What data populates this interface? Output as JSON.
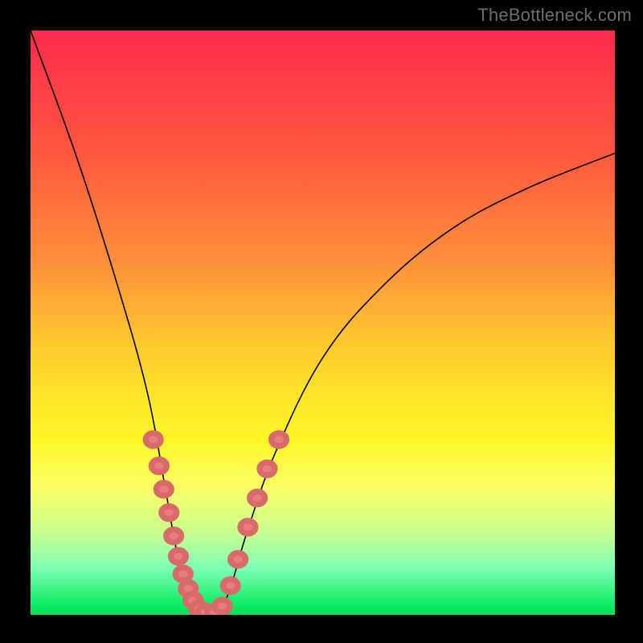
{
  "watermark": "TheBottleneck.com",
  "chart_data": {
    "type": "line",
    "title": "",
    "xlabel": "",
    "ylabel": "",
    "x_range": [
      0,
      100
    ],
    "y_range": [
      0,
      100
    ],
    "curve_left": {
      "name": "left-branch",
      "points": [
        {
          "x": 0,
          "y": 100
        },
        {
          "x": 8,
          "y": 78
        },
        {
          "x": 15,
          "y": 56
        },
        {
          "x": 20,
          "y": 38
        },
        {
          "x": 23,
          "y": 22
        },
        {
          "x": 25,
          "y": 11
        },
        {
          "x": 27,
          "y": 4
        },
        {
          "x": 29,
          "y": 0.5
        }
      ]
    },
    "curve_right": {
      "name": "right-branch",
      "points": [
        {
          "x": 32,
          "y": 0.5
        },
        {
          "x": 34,
          "y": 4
        },
        {
          "x": 37,
          "y": 14
        },
        {
          "x": 42,
          "y": 28
        },
        {
          "x": 50,
          "y": 44
        },
        {
          "x": 60,
          "y": 56
        },
        {
          "x": 72,
          "y": 66
        },
        {
          "x": 85,
          "y": 73
        },
        {
          "x": 100,
          "y": 79
        }
      ]
    },
    "highlight_band": {
      "y_min": 0,
      "y_max": 30,
      "description": "Overlay markers shown only where curves fall within lower band"
    },
    "markers_left": [
      {
        "x": 21.0,
        "y": 30.0
      },
      {
        "x": 22.0,
        "y": 25.5
      },
      {
        "x": 22.8,
        "y": 21.5
      },
      {
        "x": 23.7,
        "y": 17.5
      },
      {
        "x": 24.5,
        "y": 13.5
      },
      {
        "x": 25.3,
        "y": 10.0
      },
      {
        "x": 26.1,
        "y": 7.0
      },
      {
        "x": 27.0,
        "y": 4.5
      },
      {
        "x": 27.8,
        "y": 2.5
      },
      {
        "x": 28.8,
        "y": 1.0
      },
      {
        "x": 30.0,
        "y": 0.4
      }
    ],
    "markers_right": [
      {
        "x": 31.5,
        "y": 0.4
      },
      {
        "x": 32.8,
        "y": 1.5
      },
      {
        "x": 34.2,
        "y": 5.0
      },
      {
        "x": 35.5,
        "y": 9.5
      },
      {
        "x": 37.2,
        "y": 15.0
      },
      {
        "x": 38.8,
        "y": 20.0
      },
      {
        "x": 40.5,
        "y": 25.0
      },
      {
        "x": 42.5,
        "y": 30.0
      }
    ],
    "marker_radius": 1.3,
    "colors": {
      "curve": "#000000",
      "marker_fill": "#e77d7d",
      "background_top": "#ff2a4d",
      "background_bottom": "#00de56"
    }
  }
}
